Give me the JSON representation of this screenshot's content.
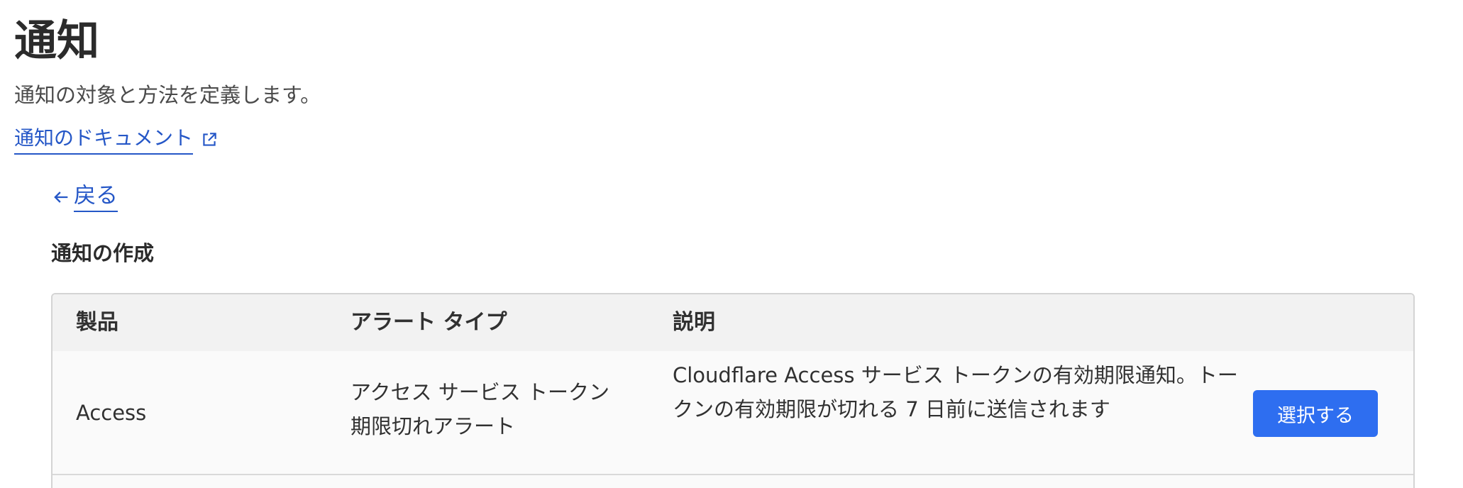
{
  "header": {
    "title": "通知",
    "description": "通知の対象と方法を定義します。",
    "doc_link_label": "通知のドキュメント",
    "doc_link_icon": "external-link-icon"
  },
  "navigation": {
    "back_label": "戻る",
    "back_icon": "arrow-left-icon"
  },
  "section": {
    "title": "通知の作成"
  },
  "table": {
    "columns": [
      "製品",
      "アラート タイプ",
      "説明"
    ],
    "rows": [
      {
        "product": "Access",
        "alert_type": "アクセス サービス トークン期限切れアラート",
        "description": "Cloudflare Access サービス トークンの有効期限通知。トークンの有効期限が切れる 7 日前に送信されます",
        "action_label": "選択する"
      }
    ]
  },
  "colors": {
    "link": "#2557c7",
    "primary_button": "#2e6ef0",
    "header_bg": "#f2f2f2",
    "row_bg": "#fafafa"
  }
}
